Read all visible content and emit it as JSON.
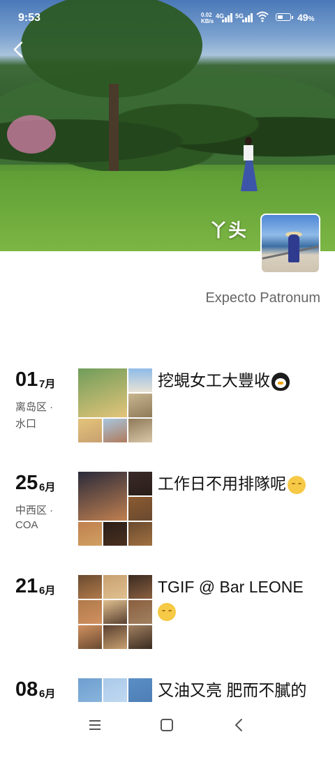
{
  "status_bar": {
    "time": "9:53",
    "net_speed_value": "0.02",
    "net_speed_unit": "KB/s",
    "signal_1": "4G",
    "signal_2": "5G",
    "battery_percent": "49",
    "battery_suffix": "%",
    "battery_level": 0.49
  },
  "profile": {
    "name": "丫头",
    "signature": "Expecto Patronum"
  },
  "timeline": [
    {
      "day": "01",
      "month": "7月",
      "location_line1": "离岛区 ·",
      "location_line2": "水口",
      "caption": "挖蜆女工大豐收",
      "emoji": "penguin-icon",
      "photo_count": 7
    },
    {
      "day": "25",
      "month": "6月",
      "location_line1": "中西区 ·",
      "location_line2": "COA",
      "caption": "工作日不用排隊呢",
      "emoji": "relieved-face-icon",
      "photo_count": 7
    },
    {
      "day": "21",
      "month": "6月",
      "location_line1": "",
      "location_line2": "",
      "caption": "TGIF @ Bar LEONE",
      "emoji": "relieved-face-icon",
      "photo_count": 9
    },
    {
      "day": "08",
      "month": "6月",
      "location_line1": "",
      "location_line2": "",
      "caption": "又油又亮 肥而不膩的",
      "emoji": "",
      "photo_count": 3
    }
  ],
  "nav_bar": {
    "items": [
      "menu-icon",
      "home-square-icon",
      "back-chevron-icon"
    ]
  },
  "colors": {
    "accent_text": "#111111",
    "secondary_text": "#666666"
  }
}
